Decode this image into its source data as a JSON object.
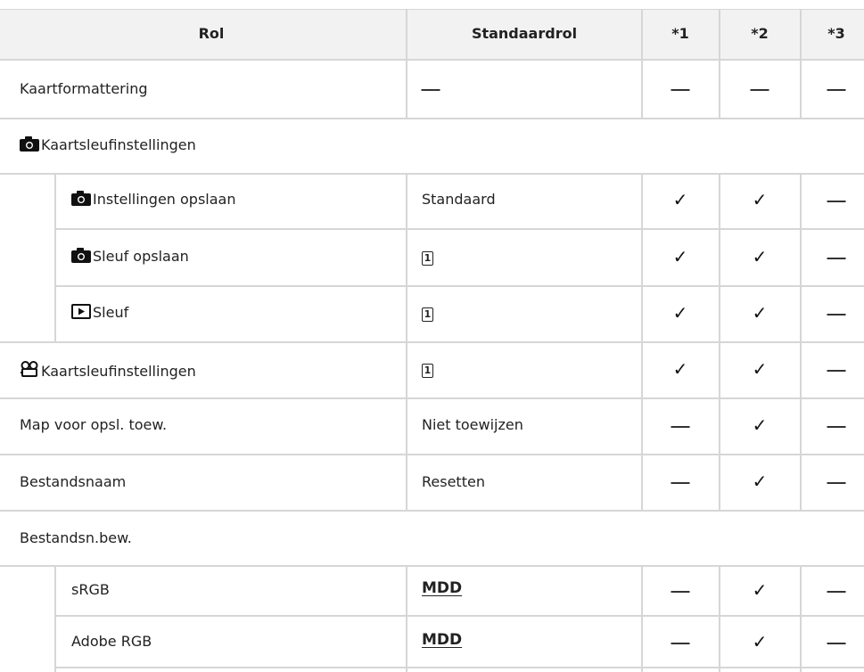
{
  "headers": {
    "rol": "Rol",
    "standaard": "Standaardrol",
    "c1": "*1",
    "c2": "*2",
    "c3": "*3"
  },
  "rows": {
    "kaartformattering": "Kaartformattering",
    "kaartsleuf_foto": "Kaartsleufinstellingen",
    "instellingen_opslaan": "Instellingen opslaan",
    "instellingen_opslaan_std": "Standaard",
    "sleuf_opslaan": "Sleuf opslaan",
    "sleuf_opslaan_std": "1",
    "play_sleuf": "Sleuf",
    "play_sleuf_std": "1",
    "kaartsleuf_video": "Kaartsleufinstellingen",
    "kaartsleuf_video_std": "1",
    "map_opsl": "Map voor opsl. toew.",
    "map_opsl_std": "Niet toewijzen",
    "bestandsnaam": "Bestandsnaam",
    "bestandsnaam_std": "Resetten",
    "bestandsn_bew": "Bestandsn.bew.",
    "srgb": "sRGB",
    "srgb_std": "MDD",
    "adobe": "Adobe RGB",
    "adobe_std": "MDD"
  },
  "symbols": {
    "check": "✓",
    "camera_icon": "camera-icon",
    "playback_icon": "playback-icon",
    "movie_icon": "movie-icon",
    "slot_icon": "slot-1-icon"
  }
}
